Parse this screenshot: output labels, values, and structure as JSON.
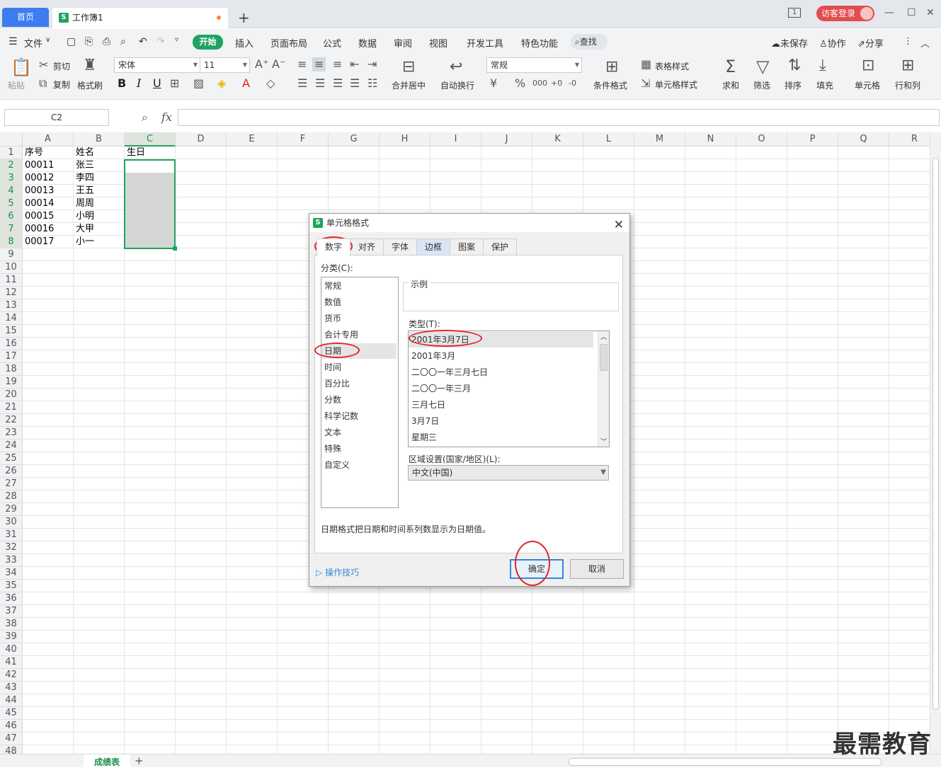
{
  "tabs": {
    "home": "首页",
    "workbook": "工作簿1",
    "add": "+"
  },
  "titlebar": {
    "badge": "1",
    "login": "访客登录"
  },
  "menu": {
    "file": "文件",
    "items": [
      "开始",
      "插入",
      "页面布局",
      "公式",
      "数据",
      "审阅",
      "视图",
      "开发工具",
      "特色功能"
    ],
    "search": "查找",
    "unsaved": "未保存",
    "collab": "协作",
    "share": "分享"
  },
  "ribbon": {
    "paste": "粘贴",
    "cut": "剪切",
    "copy": "复制",
    "format_painter": "格式刷",
    "font_name": "宋体",
    "font_size": "11",
    "bold": "B",
    "italic": "I",
    "underline": "U",
    "merge": "合并居中",
    "wrap": "自动换行",
    "number_format": "常规",
    "cond_format": "条件格式",
    "table_style": "表格样式",
    "cell_style": "单元格样式",
    "sum": "求和",
    "filter": "筛选",
    "sort": "排序",
    "fill": "填充",
    "cell": "单元格",
    "rowcol": "行和列"
  },
  "formula": {
    "namebox": "C2",
    "fx": "fx"
  },
  "columns": [
    "A",
    "B",
    "C",
    "D",
    "E",
    "F",
    "G",
    "H",
    "I",
    "J",
    "K",
    "L",
    "M",
    "N",
    "O",
    "P",
    "Q",
    "R"
  ],
  "rows": [
    "1",
    "2",
    "3",
    "4",
    "5",
    "6",
    "7",
    "8",
    "9",
    "10",
    "11",
    "12",
    "13",
    "14",
    "15",
    "16",
    "17",
    "18",
    "19",
    "20",
    "21",
    "22",
    "23",
    "24",
    "25",
    "26",
    "27",
    "28",
    "29",
    "30",
    "31",
    "32",
    "33",
    "34",
    "35",
    "36",
    "37",
    "38",
    "39",
    "40",
    "41",
    "42",
    "43",
    "44",
    "45",
    "46",
    "47",
    "48"
  ],
  "cells": {
    "header": [
      "序号",
      "姓名",
      "生日"
    ],
    "ids": [
      "00011",
      "00012",
      "00013",
      "00014",
      "00015",
      "00016",
      "00017"
    ],
    "names": [
      "张三",
      "李四",
      "王五",
      "周周",
      "小明",
      "大甲",
      "小一"
    ]
  },
  "sheet": {
    "name": "成绩表"
  },
  "watermark": "最需教育",
  "dialog": {
    "title": "单元格格式",
    "tabs": [
      "数字",
      "对齐",
      "字体",
      "边框",
      "图案",
      "保护"
    ],
    "category_label": "分类(C):",
    "categories": [
      "常规",
      "数值",
      "货币",
      "会计专用",
      "日期",
      "时间",
      "百分比",
      "分数",
      "科学记数",
      "文本",
      "特殊",
      "自定义"
    ],
    "sample_label": "示例",
    "type_label": "类型(T):",
    "types": [
      "2001年3月7日",
      "2001年3月",
      "二〇〇一年三月七日",
      "二〇〇一年三月",
      "三月七日",
      "3月7日",
      "星期三"
    ],
    "locale_label": "区域设置(国家/地区)(L):",
    "locale": "中文(中国)",
    "description": "日期格式把日期和时间系列数显示为日期值。",
    "tips": "操作技巧",
    "ok": "确定",
    "cancel": "取消"
  }
}
